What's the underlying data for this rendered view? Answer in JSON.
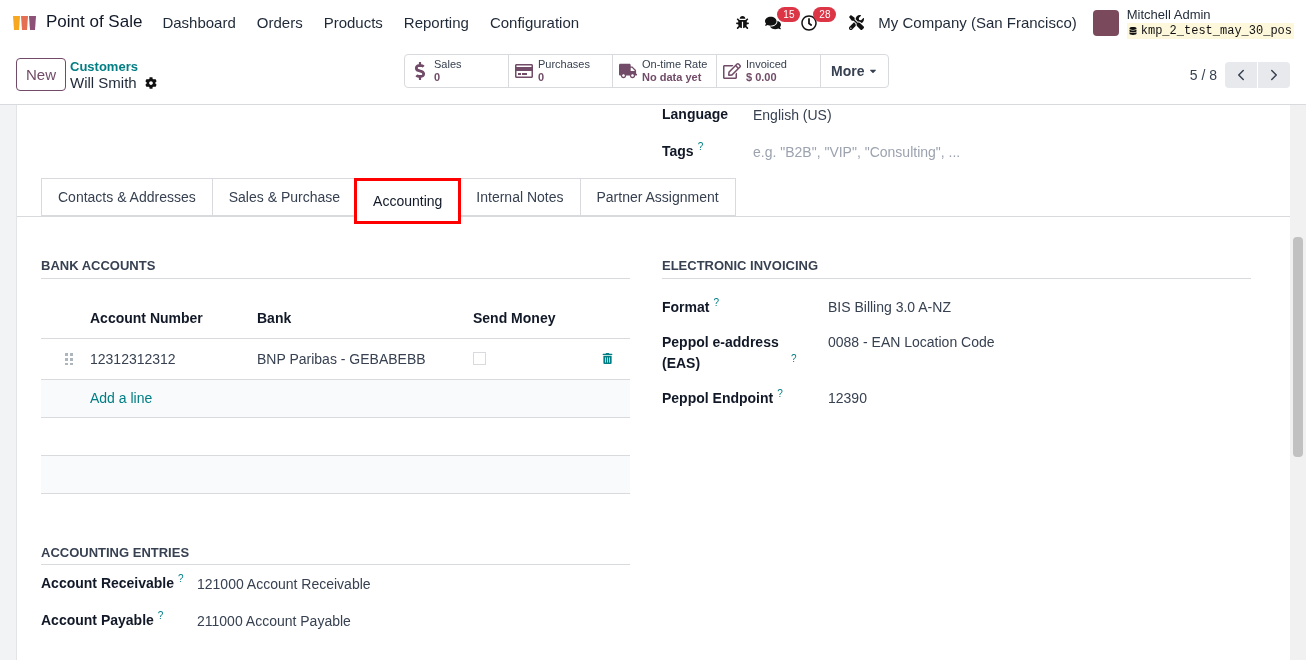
{
  "navbar": {
    "app_name": "Point of Sale",
    "menu": [
      "Dashboard",
      "Orders",
      "Products",
      "Reporting",
      "Configuration"
    ],
    "messages_badge": "15",
    "activities_badge": "28",
    "company": "My Company (San Francisco)",
    "user": "Mitchell Admin",
    "database": "kmp_2_test_may_30_pos"
  },
  "control_panel": {
    "new_button": "New",
    "breadcrumb": "Customers",
    "record": "Will Smith",
    "smart_buttons": [
      {
        "kind": "dollar",
        "label": "Sales",
        "value": "0"
      },
      {
        "kind": "card",
        "label": "Purchases",
        "value": "0"
      },
      {
        "kind": "truck",
        "label": "On-time Rate",
        "value": "No data yet"
      },
      {
        "kind": "invoice",
        "label": "Invoiced",
        "value": "$ 0.00"
      }
    ],
    "more_button": "More",
    "pager": "5 / 8"
  },
  "top_fields": [
    {
      "label": "Language",
      "value": "English (US)"
    },
    {
      "label": "Tags",
      "help": "?",
      "placeholder": "e.g. \"B2B\", \"VIP\", \"Consulting\", ..."
    }
  ],
  "tabs": [
    {
      "label": "Contacts & Addresses",
      "selected": false
    },
    {
      "label": "Sales & Purchase",
      "selected": false
    },
    {
      "label": "Accounting",
      "selected": true
    },
    {
      "label": "Internal Notes",
      "selected": false
    },
    {
      "label": "Partner Assignment",
      "selected": false
    }
  ],
  "bank_accounts": {
    "title": "BANK ACCOUNTS",
    "columns": [
      "Account Number",
      "Bank",
      "Send Money"
    ],
    "rows": [
      {
        "account_number": "12312312312",
        "bank": "BNP Paribas - GEBABEBB",
        "send_money": false
      }
    ],
    "add_line": "Add a line"
  },
  "electronic_invoicing": {
    "title": "ELECTRONIC INVOICING",
    "fields": [
      {
        "label": "Format",
        "help": "?",
        "value": "BIS Billing 3.0 A-NZ"
      },
      {
        "label": "Peppol e-address (EAS)",
        "help": "?",
        "value": "0088 - EAN Location Code"
      },
      {
        "label": "Peppol Endpoint",
        "help": "?",
        "value": "12390"
      }
    ]
  },
  "accounting_entries": {
    "title": "ACCOUNTING ENTRIES",
    "fields": [
      {
        "label": "Account Receivable",
        "help": "?",
        "value": "121000 Account Receivable"
      },
      {
        "label": "Account Payable",
        "help": "?",
        "value": "211000 Account Payable"
      }
    ]
  }
}
